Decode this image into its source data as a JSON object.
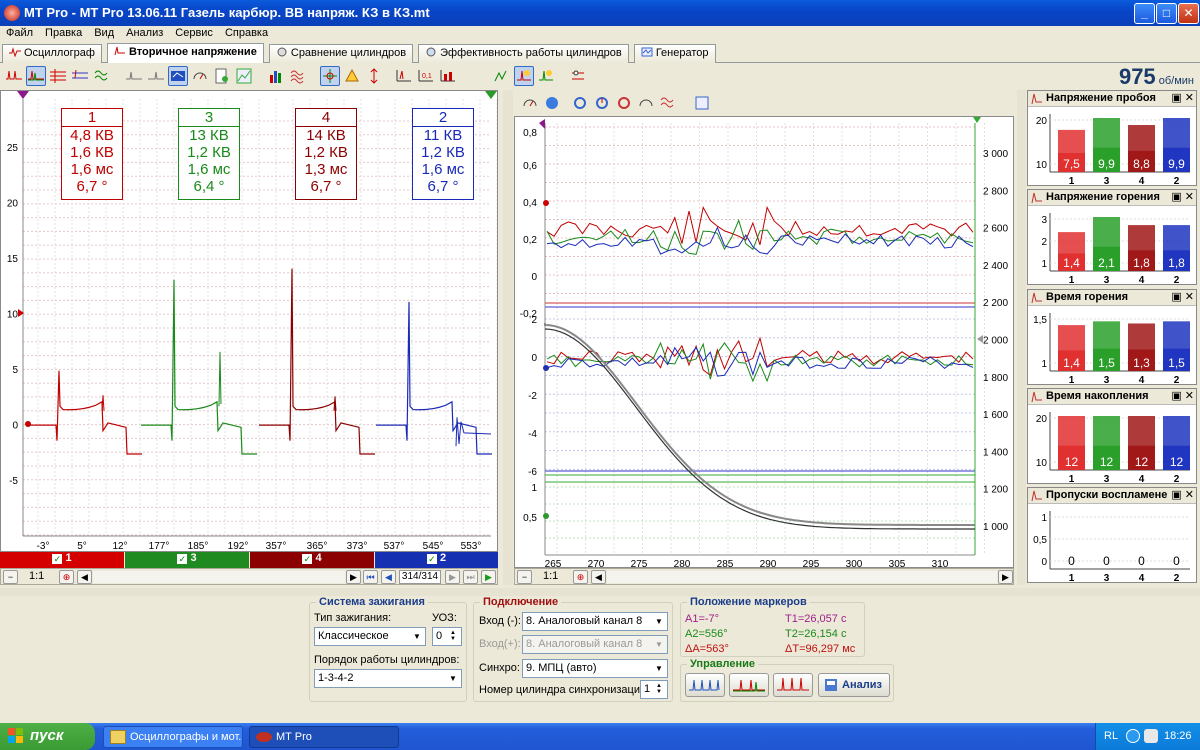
{
  "window": {
    "title": "MT Pro - MT Pro 13.06.11 Газель карбюр. ВВ напряж. КЗ в КЗ.mt",
    "minimize": "_",
    "maximize": "□",
    "close": "✕"
  },
  "menu": [
    "Файл",
    "Правка",
    "Вид",
    "Анализ",
    "Сервис",
    "Справка"
  ],
  "tabs": [
    {
      "label": "Осциллограф",
      "icon": "oscilloscope-icon"
    },
    {
      "label": "Вторичное напряжение",
      "icon": "secondary-voltage-icon",
      "active": true
    },
    {
      "label": "Сравнение цилиндров",
      "icon": "cylinder-compare-icon"
    },
    {
      "label": "Эффективность работы цилиндров",
      "icon": "cylinder-efficiency-icon"
    },
    {
      "label": "Генератор",
      "icon": "generator-icon"
    }
  ],
  "rpm": {
    "value": "975",
    "unit": "об/мин"
  },
  "left_chart": {
    "y_ticks": [
      "25",
      "20",
      "15",
      "10",
      "5",
      "0",
      "-5"
    ],
    "x_ticks": [
      "-3°",
      "5°",
      "12°",
      "177°",
      "185°",
      "192°",
      "357°",
      "365°",
      "373°",
      "537°",
      "545°",
      "553°"
    ],
    "cylinders": [
      {
        "num": "1",
        "color": "#c00000",
        "l1": "4,8 КВ",
        "l2": "1,6 КВ",
        "l3": "1,6 мс",
        "l4": "6,7 °"
      },
      {
        "num": "3",
        "color": "#1a8a1a",
        "l1": "13 КВ",
        "l2": "1,2 КВ",
        "l3": "1,6 мс",
        "l4": "6,4 °"
      },
      {
        "num": "4",
        "color": "#8b0000",
        "l1": "14 КВ",
        "l2": "1,2 КВ",
        "l3": "1,3 мс",
        "l4": "6,7 °"
      },
      {
        "num": "2",
        "color": "#1a2ab8",
        "l1": "11 КВ",
        "l2": "1,2 КВ",
        "l3": "1,6 мс",
        "l4": "6,7 °"
      }
    ],
    "legend": [
      {
        "label": "1",
        "color": "#d40000"
      },
      {
        "label": "3",
        "color": "#1f8a1f"
      },
      {
        "label": "4",
        "color": "#8b0000"
      },
      {
        "label": "2",
        "color": "#1530b0"
      }
    ],
    "zoom": "1:1",
    "counter": "314/314"
  },
  "right_chart": {
    "top_y": [
      "0,8",
      "0,6",
      "0,4",
      "0,2",
      "0",
      "-0,2"
    ],
    "mid_y": [
      "2",
      "0",
      "-2",
      "-4",
      "-6"
    ],
    "bot_y": [
      "1",
      "0,5"
    ],
    "rpm_axis": [
      "3 000",
      "2 800",
      "2 600",
      "2 400",
      "2 200",
      "2 000",
      "1 800",
      "1 600",
      "1 400",
      "1 200",
      "1 000"
    ],
    "x_ticks": [
      "265",
      "270",
      "275",
      "280",
      "285",
      "290",
      "295",
      "300",
      "305",
      "310"
    ],
    "zoom": "1:1"
  },
  "bar_panels": [
    {
      "title": "Напряжение пробоя",
      "y": [
        "20",
        "10"
      ],
      "values": [
        "7,5",
        "9,9",
        "8,8",
        "9,9"
      ],
      "fill": [
        0.78,
        1.0,
        0.87,
        1.0
      ]
    },
    {
      "title": "Напряжение горения",
      "y": [
        "3",
        "2",
        "1"
      ],
      "values": [
        "1,4",
        "2,1",
        "1,8",
        "1,8"
      ],
      "fill": [
        0.72,
        1.0,
        0.85,
        0.85
      ]
    },
    {
      "title": "Время горения",
      "y": [
        "1,5",
        "1"
      ],
      "values": [
        "1,4",
        "1,5",
        "1,3",
        "1,5"
      ],
      "fill": [
        0.85,
        0.92,
        0.88,
        0.92
      ]
    },
    {
      "title": "Время накопления",
      "y": [
        "20",
        "10"
      ],
      "values": [
        "12",
        "12",
        "12",
        "12"
      ],
      "fill": [
        1.0,
        1.0,
        1.0,
        1.0
      ]
    },
    {
      "title": "Пропуски воспламенения",
      "y": [
        "1",
        "0,5",
        "0"
      ],
      "values": [
        "0",
        "0",
        "0",
        "0"
      ],
      "fill": [
        0,
        0,
        0,
        0
      ]
    }
  ],
  "bar_labels": [
    "1",
    "3",
    "4",
    "2"
  ],
  "bar_colors": [
    "#e03030",
    "#2aa02a",
    "#a01818",
    "#2035c0"
  ],
  "ignition": {
    "title": "Система зажигания",
    "type_label": "Тип зажигания:",
    "type_value": "Классическое",
    "uoz_label": "УОЗ:",
    "uoz_value": "0",
    "order_label": "Порядок работы цилиндров:",
    "order_value": "1-3-4-2"
  },
  "connection": {
    "title": "Подключение",
    "in_minus_label": "Вход (-):",
    "in_minus_value": "8. Аналоговый канал 8",
    "in_plus_label": "Вход(+):",
    "in_plus_value": "8. Аналоговый канал 8",
    "sync_label": "Синхро:",
    "sync_value": "9. МПЦ (авто)",
    "cyl_label": "Номер цилиндра синхронизации:",
    "cyl_value": "1"
  },
  "markers": {
    "title": "Положение маркеров",
    "a1": "A1=-7°",
    "a2": "A2=556°",
    "da": "ΔA=563°",
    "t1": "T1=26,057 с",
    "t2": "T2=26,154 с",
    "dt": "ΔT=96,297 мс"
  },
  "control": {
    "title": "Управление",
    "analyze": "Анализ"
  },
  "taskbar": {
    "start": "пуск",
    "task1": "Осциллографы и мот...",
    "task2": "MT Pro",
    "lang": "RL",
    "time": "18:26"
  }
}
